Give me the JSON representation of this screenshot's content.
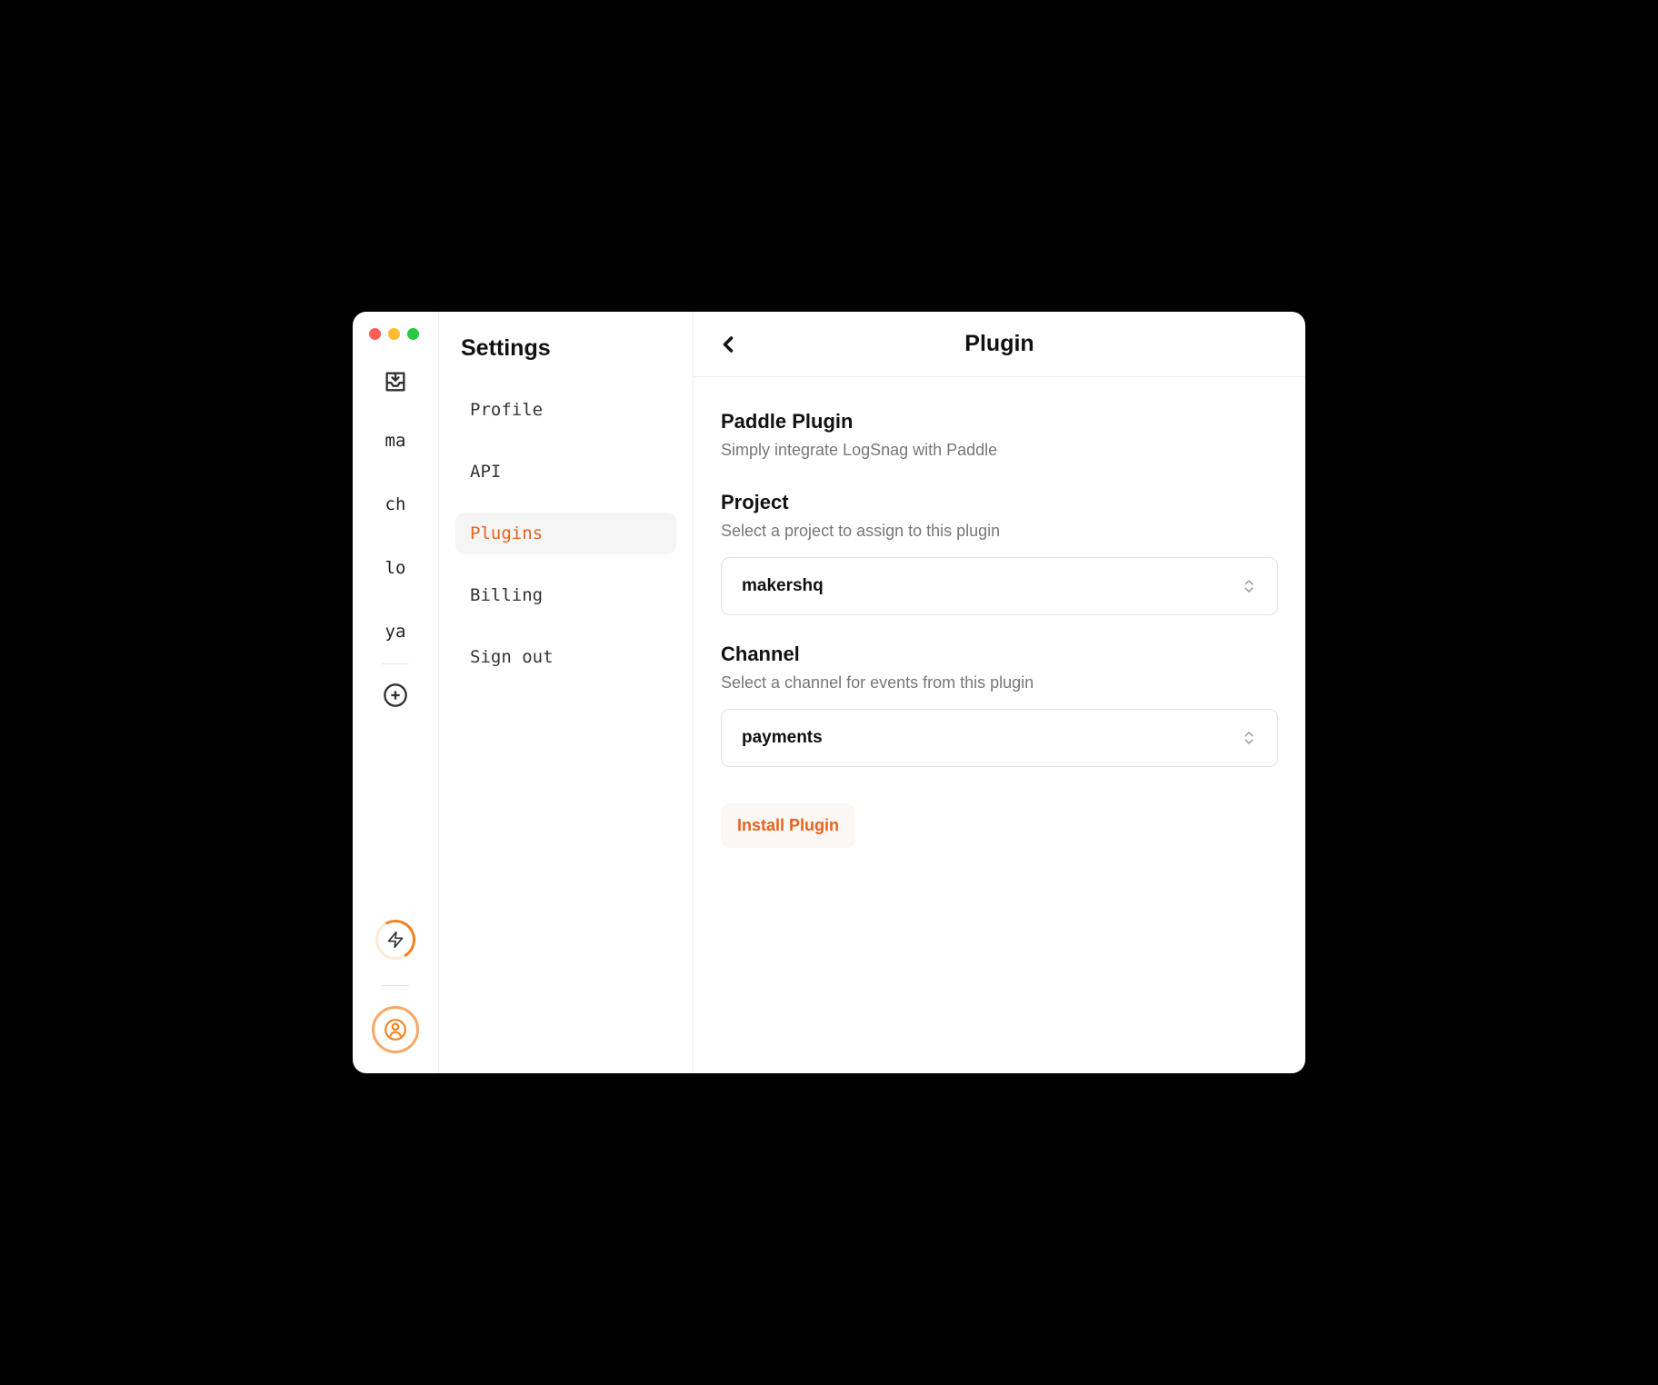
{
  "rail": {
    "items": [
      "ma",
      "ch",
      "lo",
      "ya"
    ]
  },
  "sidebar": {
    "title": "Settings",
    "items": [
      {
        "label": "Profile"
      },
      {
        "label": "API"
      },
      {
        "label": "Plugins"
      },
      {
        "label": "Billing"
      },
      {
        "label": "Sign out"
      }
    ],
    "activeIndex": 2
  },
  "main": {
    "title": "Plugin",
    "plugin": {
      "heading": "Paddle Plugin",
      "sub": "Simply integrate LogSnag with Paddle"
    },
    "project": {
      "heading": "Project",
      "sub": "Select a project to assign to this plugin",
      "value": "makershq"
    },
    "channel": {
      "heading": "Channel",
      "sub": "Select a channel for events from this plugin",
      "value": "payments"
    },
    "install_label": "Install Plugin"
  },
  "colors": {
    "accent": "#e8631c"
  }
}
